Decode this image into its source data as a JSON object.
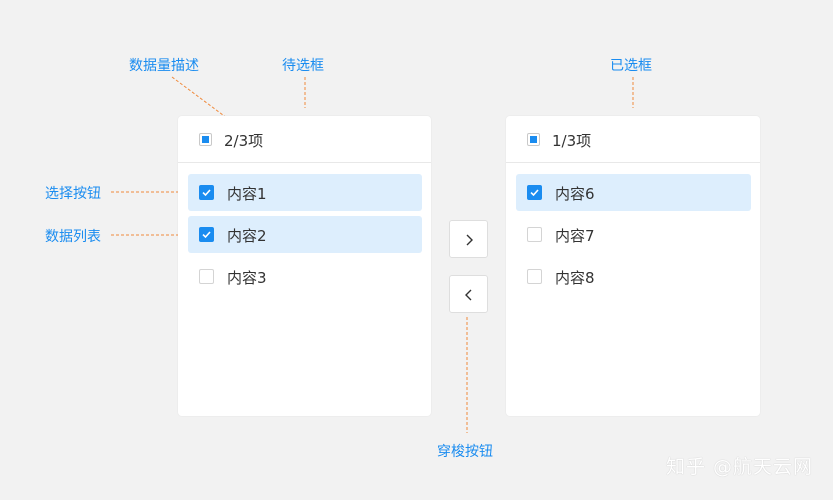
{
  "annotations": {
    "data_count_desc": "数据量描述",
    "source_box": "待选框",
    "selected_box": "已选框",
    "select_button": "选择按钮",
    "data_list": "数据列表",
    "shuttle_button": "穿梭按钮"
  },
  "left_panel": {
    "header": "2/3项",
    "items": [
      {
        "label": "内容1",
        "checked": true
      },
      {
        "label": "内容2",
        "checked": true
      },
      {
        "label": "内容3",
        "checked": false
      }
    ]
  },
  "right_panel": {
    "header": "1/3项",
    "items": [
      {
        "label": "内容6",
        "checked": true
      },
      {
        "label": "内容7",
        "checked": false
      },
      {
        "label": "内容8",
        "checked": false
      }
    ]
  },
  "buttons": {
    "move_right_icon": "chevron-right-icon",
    "move_left_icon": "chevron-left-icon"
  },
  "watermark": "知乎 @航天云网",
  "colors": {
    "accent": "#1a8cf0",
    "selected_bg": "#ddeefd",
    "annotation_line": "#f08a3c",
    "background": "#f2f2f2"
  }
}
